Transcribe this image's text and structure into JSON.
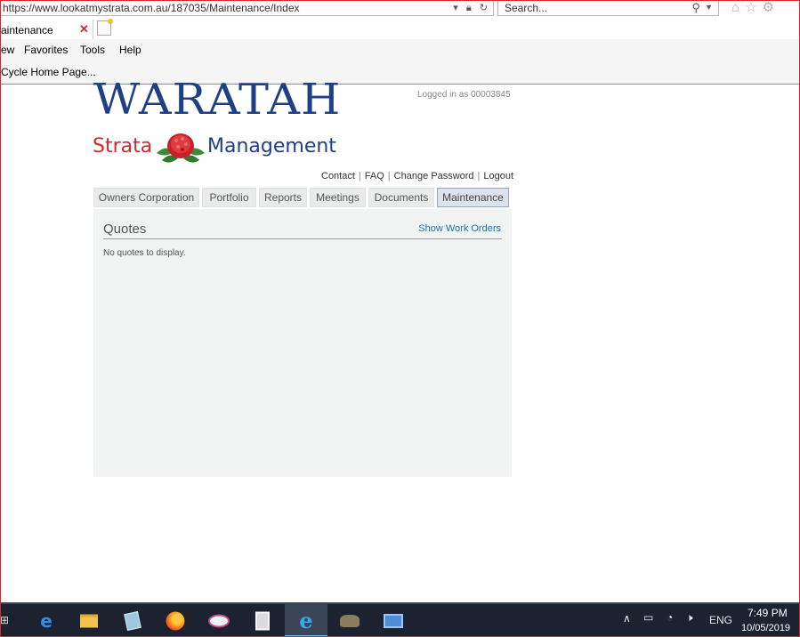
{
  "browser": {
    "address": "https://www.lookatmystrata.com.au/187035/Maintenance/Index",
    "search_placeholder": "Search...",
    "tab_title": "aintenance",
    "tab_close": "✕",
    "menu": [
      "ew",
      "Favorites",
      "Tools",
      "Help"
    ],
    "favorites_item": "Cycle Home Page..."
  },
  "header": {
    "logo_title": "WARATAH",
    "logo_left": "Strata",
    "logo_right": "Management",
    "logged_in": "Logged in as 00003845"
  },
  "top_links": {
    "contact": "Contact",
    "faq": "FAQ",
    "change_password": "Change Password",
    "logout": "Logout",
    "separator": "|"
  },
  "nav": {
    "tabs": [
      "Owners Corporation",
      "Portfolio",
      "Reports",
      "Meetings",
      "Documents",
      "Maintenance"
    ],
    "active": "Maintenance"
  },
  "panel": {
    "title": "Quotes",
    "link": "Show Work Orders",
    "empty_message": "No quotes to display."
  },
  "taskbar": {
    "apps": [
      "edge-icon",
      "file-explorer-icon",
      "notepad-icon",
      "firefox-icon",
      "paint-icon",
      "calculator-icon",
      "internet-explorer-icon",
      "gimp-icon",
      "network-app-icon"
    ],
    "language": "ENG",
    "time": "7:49 PM",
    "date": "10/05/2019"
  },
  "colors": {
    "brand_blue": "#1f3f86",
    "brand_red": "#d12a2e",
    "link_blue": "#1a6fb5",
    "window_border": "#d9262b"
  }
}
